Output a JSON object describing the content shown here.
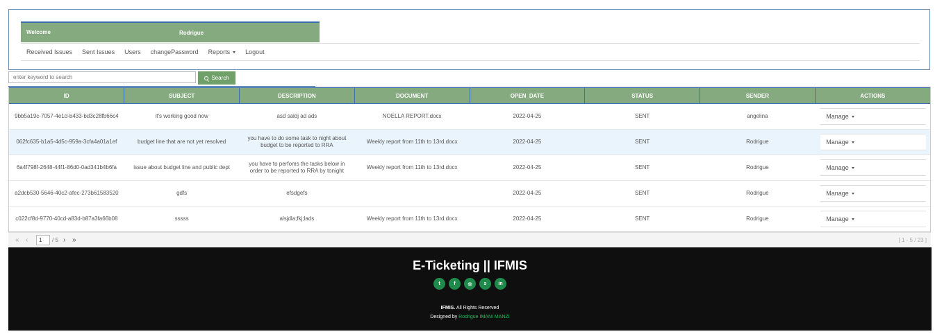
{
  "header": {
    "welcome_label": "Welcome",
    "username": "Rodrigue"
  },
  "nav": {
    "items": [
      "Received Issues",
      "Sent Issues",
      "Users",
      "changePassword",
      "Reports",
      "Logout"
    ]
  },
  "search": {
    "placeholder": "enter keyword to search",
    "button_label": "Search"
  },
  "table": {
    "columns": [
      "ID",
      "SUBJECT",
      "DESCRIPTION",
      "DOCUMENT",
      "OPEN_DATE",
      "STATUS",
      "SENDER",
      "ACTIONS"
    ],
    "action_label": "Manage",
    "rows": [
      {
        "id": "9bb5a19c-7057-4e1d-b433-bd3c28fb66c4",
        "subject": "it's working good now",
        "description": "asd saldj ad ads",
        "document": "NOELLA REPORT.docx",
        "open_date": "2022-04-25",
        "status": "SENT",
        "sender": "angelina"
      },
      {
        "id": "062fc635-b1a5-4d5c-959a-3cfa4a01a1ef",
        "subject": "budget line that are not yet resolved",
        "description": "you have to do some task to night about budget to be reported to RRA",
        "document": "Weekly report from 11th to 13rd.docx",
        "open_date": "2022-04-25",
        "status": "SENT",
        "sender": "Rodrigue"
      },
      {
        "id": "6a4f798f-2648-44f1-86d0-0ad341b4b6fa",
        "subject": "issue about budget line and public dept",
        "description": "you have to perfoms the tasks below in order to be reported to RRA by tonight",
        "document": "Weekly report from 11th to 13rd.docx",
        "open_date": "2022-04-25",
        "status": "SENT",
        "sender": "Rodrigue"
      },
      {
        "id": "a2dcb530-5646-40c2-afec-273b61583520",
        "subject": "gdfs",
        "description": "efsdgefs",
        "document": "",
        "open_date": "2022-04-25",
        "status": "SENT",
        "sender": "Rodrigue"
      },
      {
        "id": "c022cf8d-9770-40cd-a83d-b87a3fa66b08",
        "subject": "sssss",
        "description": "alsjdla;fkj;lads",
        "document": "Weekly report from 11th to 13rd.docx",
        "open_date": "2022-04-25",
        "status": "SENT",
        "sender": "Rodrigue"
      }
    ]
  },
  "pager": {
    "first": "«",
    "prev": "‹",
    "page": "1",
    "total": "/ 5",
    "next": "›",
    "last": "»",
    "range": "[ 1 - 5 / 23 ]"
  },
  "footer": {
    "brand": "E-Ticketing || IFMIS",
    "socials": [
      "twitter-icon",
      "facebook-icon",
      "instagram-icon",
      "skype-icon",
      "linkedin-icon"
    ],
    "rights_brand": "IFMIS.",
    "rights_text": " All Rights Reserved",
    "designed_prefix": "Designed by ",
    "designer": "Rodrigue IMANI MANZI"
  }
}
